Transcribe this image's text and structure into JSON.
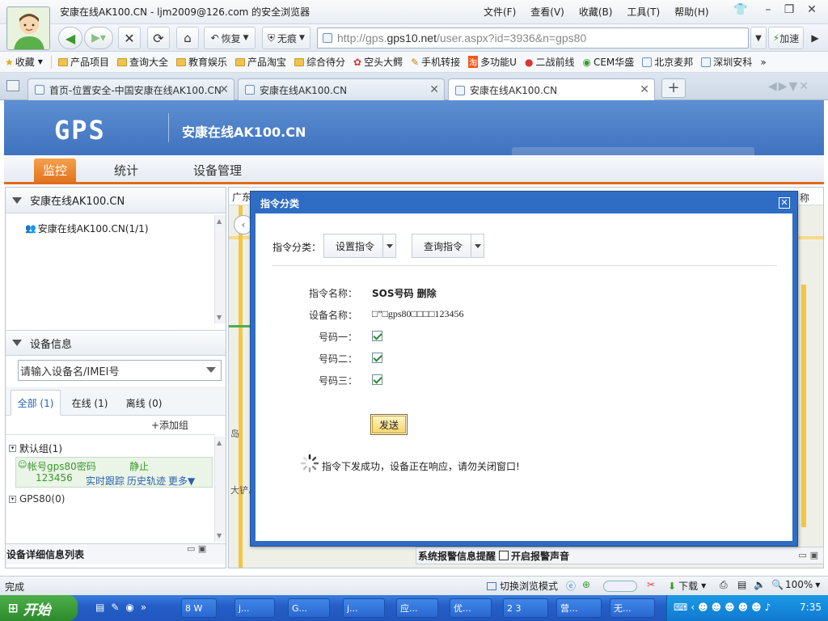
{
  "window": {
    "title": "安康在线AK100.CN - ljm2009@126.com 的安全浏览器",
    "menu": [
      "文件(F)",
      "查看(V)",
      "收藏(B)",
      "工具(T)",
      "帮助(H)"
    ]
  },
  "nav": {
    "restore": "恢复",
    "notrace": "无痕",
    "url_prefix": "http://gps.",
    "url_domain": "gps10.net",
    "url_path": "/user.aspx?id=3936&n=gps80",
    "accelerate": "加速"
  },
  "favorites": {
    "label": "收藏",
    "items": [
      "产品项目",
      "查询大全",
      "教育娱乐",
      "产品淘宝",
      "综合待分",
      "空头大鳄",
      "手机转接",
      "多功能U",
      "二战前线",
      "CEM华盛",
      "北京麦邦",
      "深圳安科"
    ],
    "more": "»"
  },
  "tabs": [
    {
      "label": "首页-位置安全-中国安康在线AK100.CN"
    },
    {
      "label": "安康在线AK100.CN"
    },
    {
      "label": "安康在线AK100.CN"
    }
  ],
  "app": {
    "logo": "GPS",
    "title": "安康在线AK100.CN",
    "nav": [
      "监控",
      "统计",
      "设备管理"
    ]
  },
  "left": {
    "tree_header": "安康在线AK100.CN",
    "tree_item": "安康在线AK100.CN(1/1)",
    "device_header": "设备信息",
    "device_placeholder": "请输入设备名/IMEI号",
    "filters": [
      "全部 (1)",
      "在线 (1)",
      "离线 (0)"
    ],
    "add_group": "+添加组",
    "default_group": "默认组(1)",
    "device_name_line1": "帐号gps80密码",
    "device_name_line2": "123456",
    "device_state": "静止",
    "action_track": "实时跟踪",
    "action_history": "历史轨迹",
    "action_more": "更多▼",
    "group2": "GPS80(0)",
    "detail_header": "设备详细信息列表"
  },
  "map": {
    "info_text": "广东",
    "right_label": "称",
    "alarm_title": "系统报警信息提醒",
    "alarm_sound": "开启报警声音",
    "map_label_1": "大铲岛",
    "map_label_2": "岛"
  },
  "dialog": {
    "title": "指令分类",
    "category_label": "指令分类：",
    "select_set": "设置指令",
    "select_query": "查询指令",
    "cmd_name_label": "指令名称：",
    "cmd_name_value": "SOS号码 删除",
    "device_label": "设备名称：",
    "device_value": "□”□gps80□□□□123456",
    "num1_label": "号码一：",
    "num2_label": "号码二：",
    "num3_label": "号码三：",
    "send": "发送",
    "status": "指令下发成功，设备正在响应，请勿关闭窗口!"
  },
  "statusbar": {
    "left": "完成",
    "switch_mode": "切换浏览模式",
    "download": "下载",
    "zoom": "100%"
  },
  "taskbar": {
    "start": "开始",
    "tasks": [
      "8 W",
      "j...",
      "G...",
      "j...",
      "应...",
      "优...",
      "2 3",
      "营...",
      "无..."
    ],
    "clock": "7:35"
  }
}
